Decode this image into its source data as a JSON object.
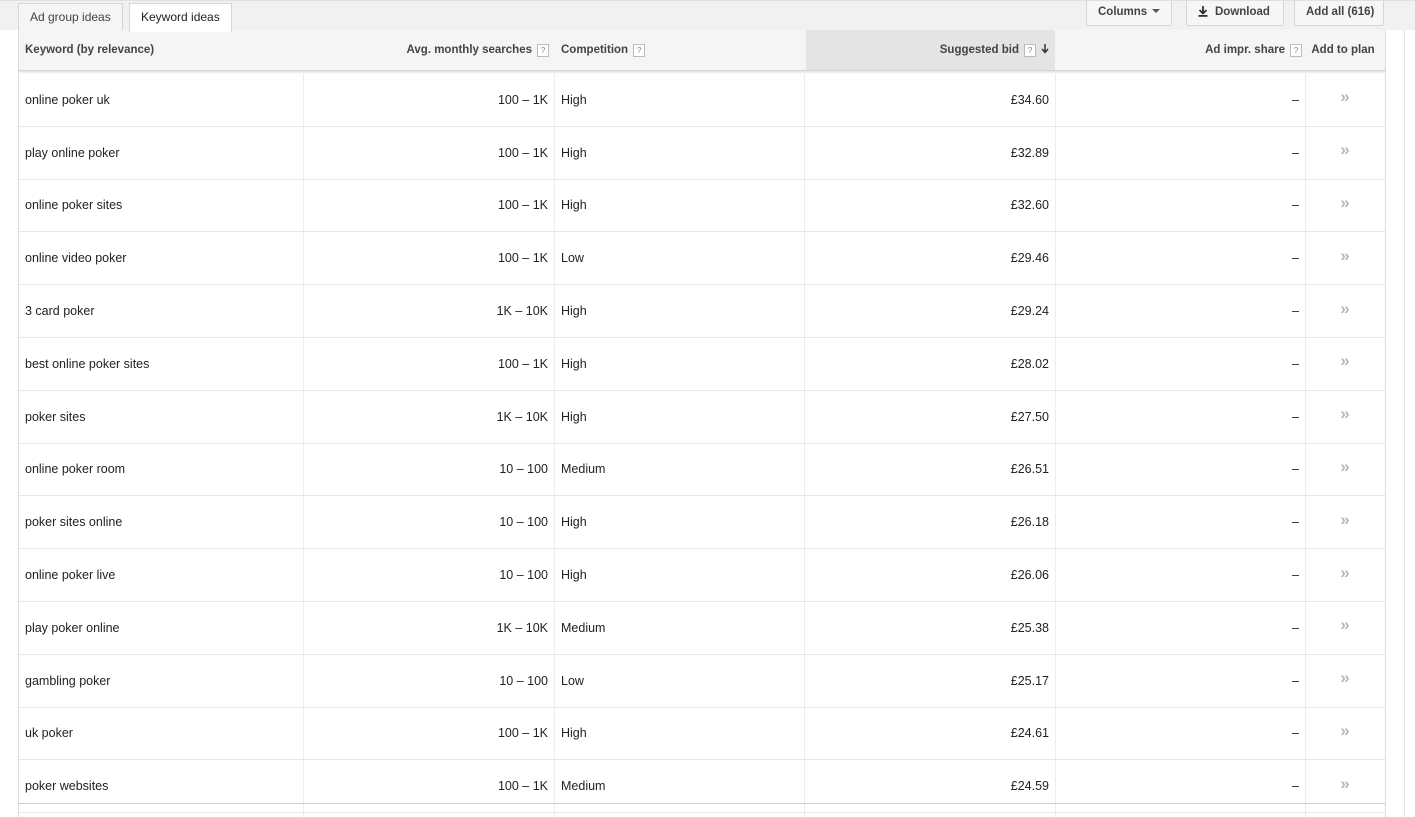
{
  "tabs": [
    {
      "label": "Ad group ideas",
      "active": false
    },
    {
      "label": "Keyword ideas",
      "active": true
    }
  ],
  "toolbar": {
    "columns_label": "Columns",
    "download_label": "Download",
    "add_all_label": "Add all (616)"
  },
  "table": {
    "headers": {
      "keyword": "Keyword (by relevance)",
      "avg_searches": "Avg. monthly searches",
      "competition": "Competition",
      "suggested_bid": "Suggested bid",
      "ad_impr_share": "Ad impr. share",
      "add_to_plan": "Add to plan",
      "help_glyph": "?"
    },
    "sorted_column": "suggested_bid",
    "sort_direction": "descending",
    "rows": [
      {
        "keyword": "online poker uk",
        "avg": "100 – 1K",
        "competition": "High",
        "bid": "£34.60",
        "impr": "–",
        "add": "»"
      },
      {
        "keyword": "play online poker",
        "avg": "100 – 1K",
        "competition": "High",
        "bid": "£32.89",
        "impr": "–",
        "add": "»"
      },
      {
        "keyword": "online poker sites",
        "avg": "100 – 1K",
        "competition": "High",
        "bid": "£32.60",
        "impr": "–",
        "add": "»"
      },
      {
        "keyword": "online video poker",
        "avg": "100 – 1K",
        "competition": "Low",
        "bid": "£29.46",
        "impr": "–",
        "add": "»"
      },
      {
        "keyword": "3 card poker",
        "avg": "1K – 10K",
        "competition": "High",
        "bid": "£29.24",
        "impr": "–",
        "add": "»"
      },
      {
        "keyword": "best online poker sites",
        "avg": "100 – 1K",
        "competition": "High",
        "bid": "£28.02",
        "impr": "–",
        "add": "»"
      },
      {
        "keyword": "poker sites",
        "avg": "1K – 10K",
        "competition": "High",
        "bid": "£27.50",
        "impr": "–",
        "add": "»"
      },
      {
        "keyword": "online poker room",
        "avg": "10 – 100",
        "competition": "Medium",
        "bid": "£26.51",
        "impr": "–",
        "add": "»"
      },
      {
        "keyword": "poker sites online",
        "avg": "10 – 100",
        "competition": "High",
        "bid": "£26.18",
        "impr": "–",
        "add": "»"
      },
      {
        "keyword": "online poker live",
        "avg": "10 – 100",
        "competition": "High",
        "bid": "£26.06",
        "impr": "–",
        "add": "»"
      },
      {
        "keyword": "play poker online",
        "avg": "1K – 10K",
        "competition": "Medium",
        "bid": "£25.38",
        "impr": "–",
        "add": "»"
      },
      {
        "keyword": "gambling poker",
        "avg": "10 – 100",
        "competition": "Low",
        "bid": "£25.17",
        "impr": "–",
        "add": "»"
      },
      {
        "keyword": "uk poker",
        "avg": "100 – 1K",
        "competition": "High",
        "bid": "£24.61",
        "impr": "–",
        "add": "»"
      },
      {
        "keyword": "poker websites",
        "avg": "100 – 1K",
        "competition": "Medium",
        "bid": "£24.59",
        "impr": "–",
        "add": "»"
      }
    ]
  },
  "colors": {
    "accent": "#4a8af4",
    "header_bg": "#f5f5f5",
    "sorted_header_bg": "#e4e4e4",
    "row_border": "#e6e6e6",
    "add_arrow": "#b8b8b8"
  }
}
